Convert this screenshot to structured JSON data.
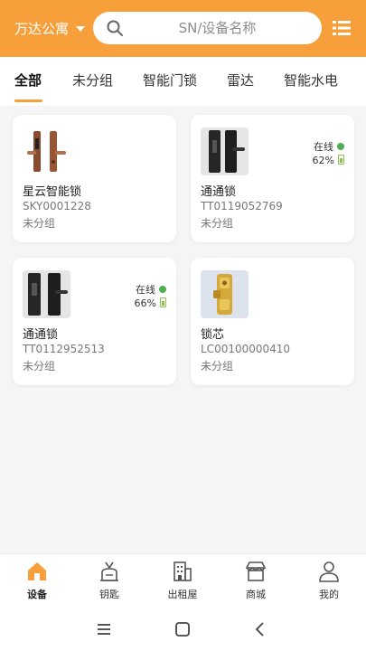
{
  "header": {
    "location": "万达公寓",
    "search_placeholder": "SN/设备名称",
    "accent_color": "#f7a03b"
  },
  "tabs": [
    {
      "label": "全部",
      "active": true
    },
    {
      "label": "未分组"
    },
    {
      "label": "智能门锁"
    },
    {
      "label": "雷达"
    },
    {
      "label": "智能水电"
    }
  ],
  "devices": [
    {
      "name": "星云智能锁",
      "sn": "SKY0001228",
      "group": "未分组",
      "image": "copper-door-lock"
    },
    {
      "name": "通通锁",
      "sn": "TT0119052769",
      "group": "未分组",
      "image": "black-door-lock",
      "status": "在线",
      "battery": "62%"
    },
    {
      "name": "通通锁",
      "sn": "TT0112952513",
      "group": "未分组",
      "image": "black-door-lock",
      "status": "在线",
      "battery": "66%"
    },
    {
      "name": "锁芯",
      "sn": "LC00100000410",
      "group": "未分组",
      "image": "brass-lock-cylinder"
    }
  ],
  "tabbar": [
    {
      "label": "设备",
      "icon": "home-icon",
      "active": true
    },
    {
      "label": "钥匙",
      "icon": "key-icon"
    },
    {
      "label": "出租屋",
      "icon": "building-icon"
    },
    {
      "label": "商城",
      "icon": "shop-icon"
    },
    {
      "label": "我的",
      "icon": "user-icon"
    }
  ]
}
